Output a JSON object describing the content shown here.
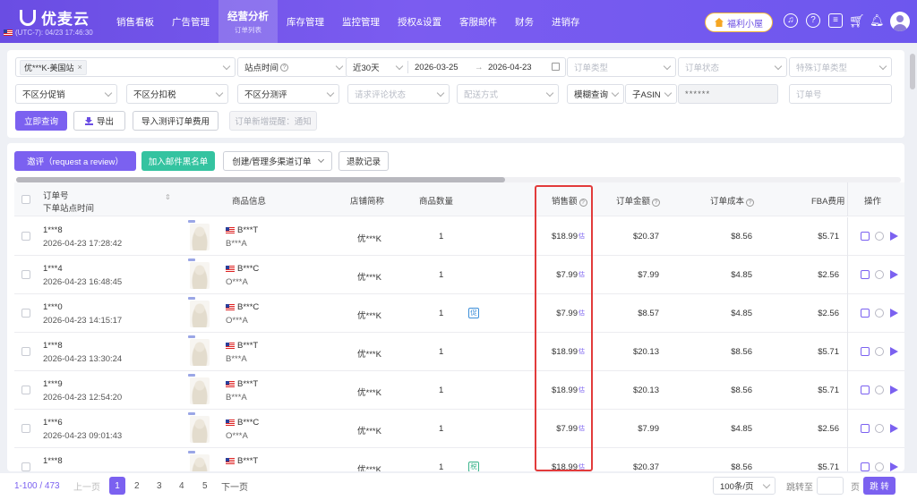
{
  "app": {
    "name": "优麦云",
    "timezone": "(UTC-7): 04/23 17:46:30"
  },
  "nav": [
    {
      "label": "销售看板",
      "sub": ""
    },
    {
      "label": "广告管理",
      "sub": ""
    },
    {
      "label": "经营分析",
      "sub": "订单列表"
    },
    {
      "label": "库存管理",
      "sub": ""
    },
    {
      "label": "监控管理",
      "sub": ""
    },
    {
      "label": "授权&设置",
      "sub": ""
    },
    {
      "label": "客服邮件",
      "sub": ""
    },
    {
      "label": "财务",
      "sub": ""
    },
    {
      "label": "进销存",
      "sub": ""
    }
  ],
  "header": {
    "welfare_label": "福利小屋",
    "icons": [
      "headset-icon",
      "help-icon",
      "message-icon",
      "cart-icon",
      "bell-icon",
      "avatar"
    ]
  },
  "filters": {
    "store_tag": "优***K-美国站",
    "time_type": "站点时间",
    "range": "近30天",
    "date_from": "2026-03-25",
    "date_to": "2026-04-23",
    "order_type": "订单类型",
    "order_status": "订单状态",
    "special_type": "特殊订单类型",
    "promo": "不区分促销",
    "tax": "不区分扣税",
    "review": "不区分测评",
    "review_status": "请求评论状态",
    "delivery": "配送方式",
    "match_mode": "模糊查询",
    "search_field": "子ASIN",
    "search_value": "******",
    "order_no": "订单号",
    "query_btn": "立即查询",
    "export_btn": "导出",
    "import_btn": "导入测评订单费用",
    "notice_btn": "订单新增提醒：通知"
  },
  "actions": {
    "review_btn": "邀评（request a review）",
    "blacklist_btn": "加入邮件黑名单",
    "multichannel_btn": "创建/管理多渠道订单",
    "refund_btn": "退款记录"
  },
  "table": {
    "headers": {
      "order_no": "订单号",
      "order_time": "下单站点时间",
      "product": "商品信息",
      "store": "店铺简称",
      "qty": "商品数量",
      "sales": "销售额",
      "order_amount": "订单金额",
      "order_cost": "订单成本",
      "fba": "FBA费用",
      "ops": "操作"
    },
    "rows": [
      {
        "order": "1***8",
        "time": "2026-04-23 17:28:42",
        "asin": "B***T",
        "sku": "B***A",
        "store": "优***K",
        "qty": "1",
        "badge": "",
        "sales": "$18.99",
        "amount": "$20.37",
        "cost": "$8.56",
        "fba": "$5.71"
      },
      {
        "order": "1***4",
        "time": "2026-04-23 16:48:45",
        "asin": "B***C",
        "sku": "O***A",
        "store": "优***K",
        "qty": "1",
        "badge": "",
        "sales": "$7.99",
        "amount": "$7.99",
        "cost": "$4.85",
        "fba": "$2.56"
      },
      {
        "order": "1***0",
        "time": "2026-04-23 14:15:17",
        "asin": "B***C",
        "sku": "O***A",
        "store": "优***K",
        "qty": "1",
        "badge": "促",
        "sales": "$7.99",
        "amount": "$8.57",
        "cost": "$4.85",
        "fba": "$2.56"
      },
      {
        "order": "1***8",
        "time": "2026-04-23 13:30:24",
        "asin": "B***T",
        "sku": "B***A",
        "store": "优***K",
        "qty": "1",
        "badge": "",
        "sales": "$18.99",
        "amount": "$20.13",
        "cost": "$8.56",
        "fba": "$5.71"
      },
      {
        "order": "1***9",
        "time": "2026-04-23 12:54:20",
        "asin": "B***T",
        "sku": "B***A",
        "store": "优***K",
        "qty": "1",
        "badge": "",
        "sales": "$18.99",
        "amount": "$20.13",
        "cost": "$8.56",
        "fba": "$5.71"
      },
      {
        "order": "1***6",
        "time": "2026-04-23 09:01:43",
        "asin": "B***C",
        "sku": "O***A",
        "store": "优***K",
        "qty": "1",
        "badge": "",
        "sales": "$7.99",
        "amount": "$7.99",
        "cost": "$4.85",
        "fba": "$2.56"
      },
      {
        "order": "1***8",
        "time": "",
        "asin": "B***T",
        "sku": "",
        "store": "优***K",
        "qty": "1",
        "badge": "税",
        "sales": "$18.99",
        "amount": "$20.37",
        "cost": "$8.56",
        "fba": "$5.71"
      }
    ],
    "sales_sup": "估"
  },
  "pagination": {
    "range": "1-100 / 473",
    "prev": "上一页",
    "pages": [
      "1",
      "2",
      "3",
      "4",
      "5"
    ],
    "next": "下一页",
    "page_size": "100条/页",
    "jump_label": "跳转至",
    "page_unit": "页",
    "jump_btn": "跳 转"
  },
  "colors": {
    "brand": "#6a4de3",
    "primary_btn": "#7b61f0",
    "green_btn": "#34c3a0",
    "highlight": "#e23b3b"
  }
}
